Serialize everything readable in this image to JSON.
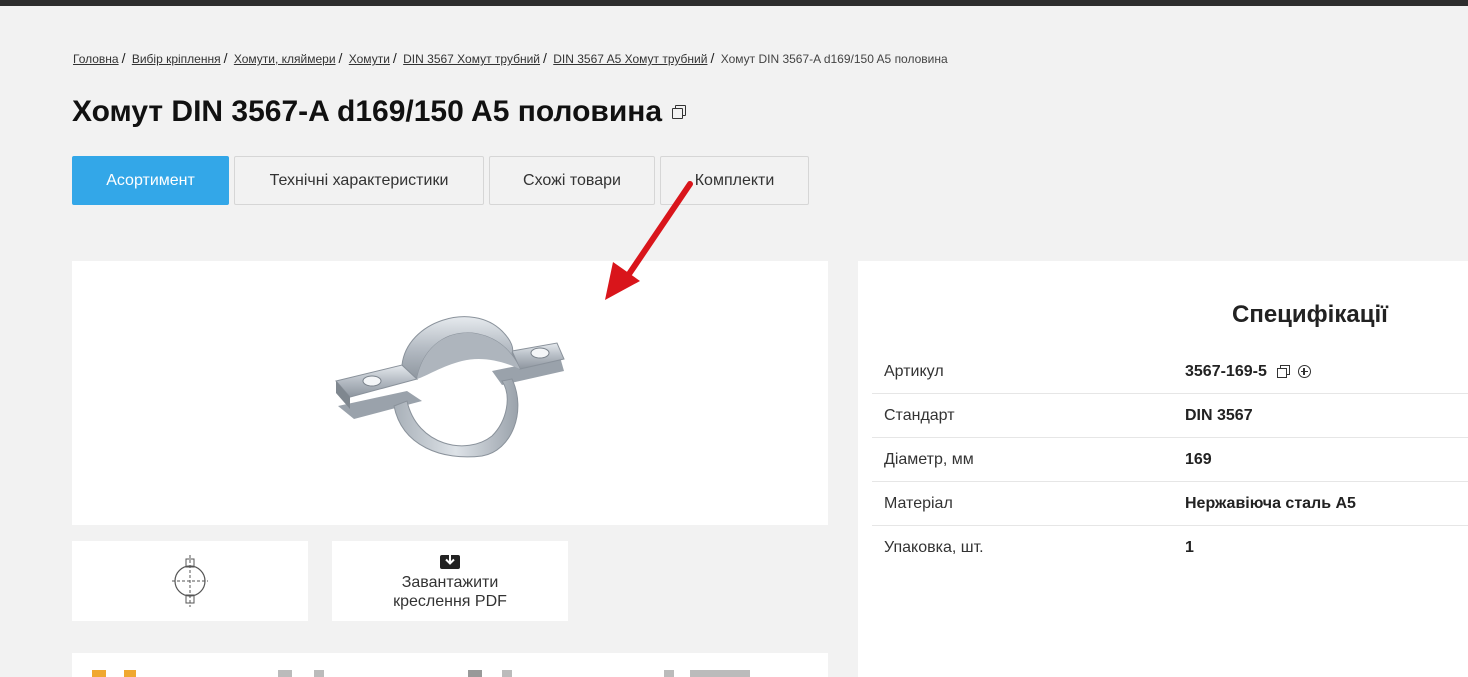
{
  "breadcrumb": {
    "items": [
      "Головна",
      "Вибір кріплення",
      "Хомути, кляймери",
      "Хомути",
      "DIN 3567 Хомут трубний",
      "DIN 3567 A5 Хомут трубний"
    ],
    "current": "Хомут DIN 3567-A d169/150 A5 половина"
  },
  "page": {
    "title": "Хомут DIN 3567-A d169/150 A5 половина"
  },
  "tabs": [
    {
      "label": "Асортимент"
    },
    {
      "label": "Технічні характеристики"
    },
    {
      "label": "Схожі товари"
    },
    {
      "label": "Комплекти"
    }
  ],
  "downloads": {
    "pdf_label_line1": "Завантажити",
    "pdf_label_line2": "креслення PDF"
  },
  "specs": {
    "title": "Специфікації",
    "rows": [
      {
        "key": "Артикул",
        "value": "3567-169-5"
      },
      {
        "key": "Стандарт",
        "value": "DIN 3567"
      },
      {
        "key": "Діаметр, мм",
        "value": "169"
      },
      {
        "key": "Матеріал",
        "value": "Нержавіюча сталь A5"
      },
      {
        "key": "Упаковка, шт.",
        "value": "1"
      }
    ]
  },
  "colors": {
    "accent": "#33a7e8",
    "arrow": "#d9151b"
  }
}
